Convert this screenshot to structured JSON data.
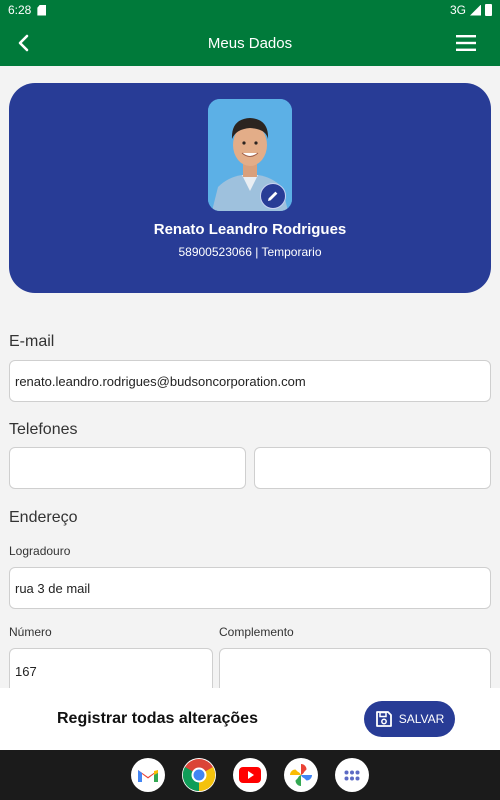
{
  "status_bar": {
    "time": "6:28",
    "network": "3G"
  },
  "app_bar": {
    "title": "Meus Dados",
    "back_icon": "arrow-back-icon",
    "menu_icon": "hamburger-menu-icon"
  },
  "profile": {
    "name": "Renato Leandro Rodrigues",
    "subtitle": "58900523066 | Temporario",
    "edit_icon": "pencil-icon"
  },
  "form": {
    "email": {
      "title": "E-mail",
      "value": "renato.leandro.rodrigues@budsoncorporation.com"
    },
    "phones": {
      "title": "Telefones",
      "phone1": "",
      "phone2": ""
    },
    "address": {
      "title": "Endereço",
      "street_label": "Logradouro",
      "street_value": "rua 3 de mail",
      "number_label": "Número",
      "number_value": "167",
      "complement_label": "Complemento",
      "complement_value": ""
    }
  },
  "bottom_bar": {
    "text": "Registrar todas alterações",
    "save_label": "SALVAR",
    "save_icon": "floppy-disk-icon"
  },
  "dock": {
    "apps": [
      "gmail-icon",
      "chrome-icon",
      "youtube-icon",
      "photos-icon",
      "app-drawer-icon"
    ]
  },
  "colors": {
    "green": "#007a3a",
    "navy": "#283c96",
    "background": "#f3f3f3"
  }
}
